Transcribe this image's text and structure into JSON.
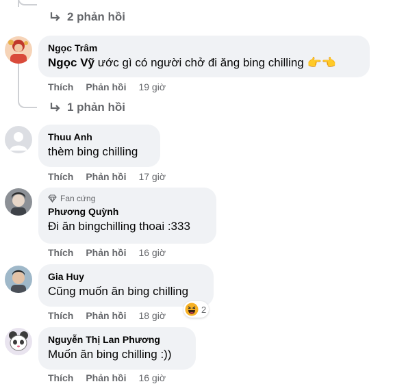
{
  "thread_replies_top": {
    "label": "2 phản hồi"
  },
  "thread_replies_mid": {
    "label": "1 phản hồi"
  },
  "comments": [
    {
      "author": "Ngọc Trâm",
      "mention": "Ngọc Vỹ",
      "text": " ước gì có người chở đi ăng bing chilling ",
      "emoji": "👉👈",
      "like": "Thích",
      "reply": "Phản hồi",
      "time": "19 giờ"
    },
    {
      "author": "Thuu Anh",
      "text": "thèm bing chilling",
      "like": "Thích",
      "reply": "Phản hồi",
      "time": "17 giờ"
    },
    {
      "badge": "Fan cứng",
      "author": "Phương Quỳnh",
      "text": "Đi ăn bingchilling thoai :333",
      "like": "Thích",
      "reply": "Phản hồi",
      "time": "16 giờ"
    },
    {
      "author": "Gia Huy",
      "text": "Cũng muốn ăn bing chilling",
      "like": "Thích",
      "reply": "Phản hồi",
      "time": "18 giờ",
      "reaction_count": "2"
    },
    {
      "author": "Nguyễn Thị Lan Phương",
      "text": "Muốn ăn bing chilling :))",
      "like": "Thích",
      "reply": "Phản hồi",
      "time": "16 giờ"
    }
  ],
  "colors": {
    "bubble": "#f0f2f5",
    "muted": "#65676b",
    "thread": "#ced0d4",
    "haha": "#f7b125"
  },
  "icons": {
    "reply_arrow": "reply-arrow-icon",
    "diamond": "diamond-icon",
    "reaction": "haha-reaction-icon"
  }
}
